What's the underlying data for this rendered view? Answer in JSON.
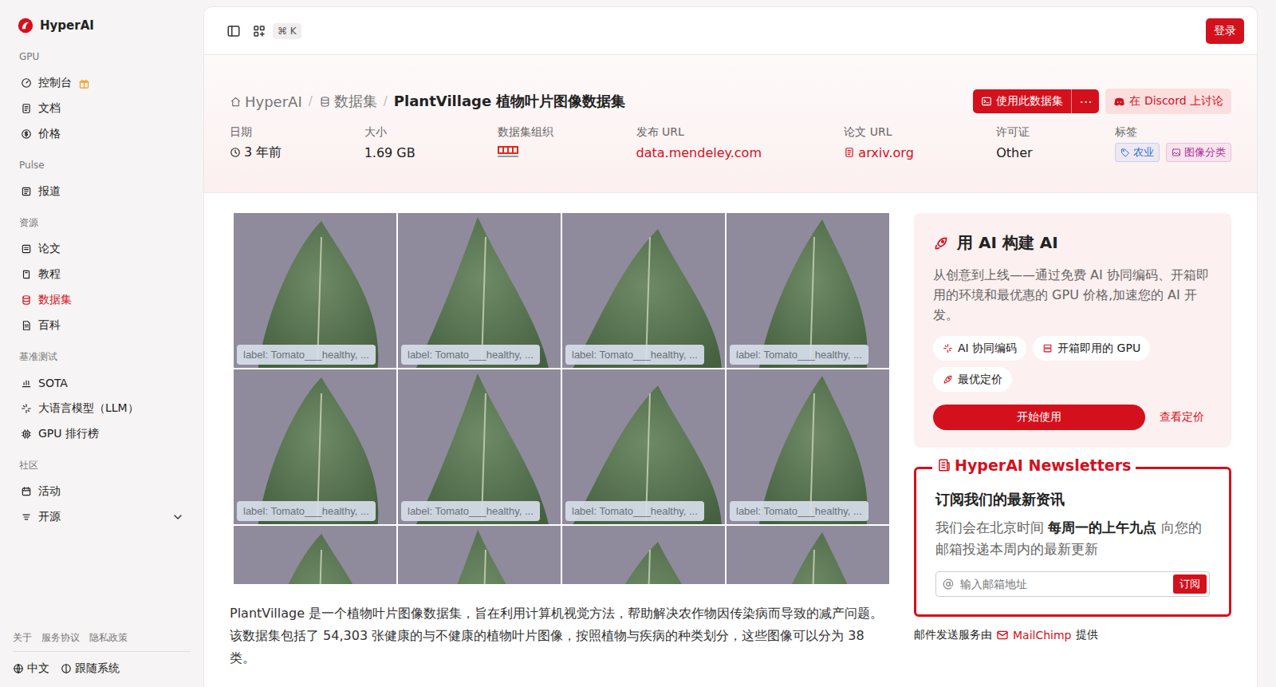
{
  "brand": {
    "name": "HyperAI"
  },
  "sidebar": {
    "sections": [
      {
        "title": "GPU",
        "items": [
          {
            "label": "控制台",
            "kind": "promo",
            "selected": false
          },
          {
            "label": "文档",
            "kind": "link",
            "selected": false
          },
          {
            "label": "价格",
            "kind": "link",
            "selected": false
          }
        ]
      },
      {
        "title": "Pulse",
        "items": [
          {
            "label": "报道",
            "kind": "link",
            "selected": false
          }
        ]
      },
      {
        "title": "资源",
        "items": [
          {
            "label": "论文",
            "kind": "link",
            "selected": false
          },
          {
            "label": "教程",
            "kind": "link",
            "selected": false
          },
          {
            "label": "数据集",
            "kind": "link",
            "selected": true
          },
          {
            "label": "百科",
            "kind": "link",
            "selected": false
          }
        ]
      },
      {
        "title": "基准测试",
        "items": [
          {
            "label": "SOTA",
            "kind": "link",
            "selected": false
          },
          {
            "label": "大语言模型（LLM）",
            "kind": "link",
            "selected": false
          },
          {
            "label": "GPU 排行榜",
            "kind": "link",
            "selected": false
          }
        ]
      },
      {
        "title": "社区",
        "items": [
          {
            "label": "活动",
            "kind": "link",
            "selected": false
          },
          {
            "label": "开源",
            "kind": "group",
            "selected": false,
            "expanded": false
          }
        ]
      }
    ],
    "footer_links": [
      "关于",
      "服务协议",
      "隐私政策"
    ],
    "language": "中文",
    "theme": "跟随系统"
  },
  "topbar": {
    "shortcut": "⌘ K",
    "login": "登录"
  },
  "breadcrumb": {
    "separator": "/",
    "items": [
      "HyperAI",
      "数据集",
      "PlantVillage 植物叶片图像数据集"
    ]
  },
  "actions": {
    "use": "使用此数据集",
    "more": "⋯",
    "discord": "在 Discord 上讨论"
  },
  "meta": [
    {
      "label": "日期",
      "kind": "time",
      "value": "3 年前"
    },
    {
      "label": "大小",
      "kind": "text",
      "value": "1.69 GB"
    },
    {
      "label": "数据集组织",
      "kind": "logo"
    },
    {
      "label": "发布 URL",
      "kind": "link",
      "value": "data.mendeley.com"
    },
    {
      "label": "论文 URL",
      "kind": "paper",
      "value": "arxiv.org"
    },
    {
      "label": "许可证",
      "kind": "text",
      "value": "Other"
    },
    {
      "label": "标签",
      "kind": "tags",
      "tags": [
        {
          "label": "农业",
          "color": "#2f6fde"
        },
        {
          "label": "图像分类",
          "color": "#b0309e"
        }
      ]
    }
  ],
  "gallery": [
    {
      "kind": "labeled",
      "label": "label: Tomato___healthy, ..."
    },
    {
      "kind": "labeled",
      "label": "label: Tomato___healthy, ..."
    },
    {
      "kind": "labeled",
      "label": "label: Tomato___healthy, ..."
    },
    {
      "kind": "labeled",
      "label": "label: Tomato___healthy, ..."
    },
    {
      "kind": "labeled",
      "label": "label: Tomato___healthy, ..."
    },
    {
      "kind": "labeled",
      "label": "label: Tomato___healthy, ..."
    },
    {
      "kind": "labeled",
      "label": "label: Tomato___healthy, ..."
    },
    {
      "kind": "labeled",
      "label": "label: Tomato___healthy, ..."
    },
    {
      "kind": "cut"
    },
    {
      "kind": "cut"
    },
    {
      "kind": "cut"
    },
    {
      "kind": "cut"
    }
  ],
  "description": "PlantVillage 是一个植物叶片图像数据集，旨在利用计算机视觉方法，帮助解决农作物因传染病而导致的减产问题。该数据集包括了 54,303 张健康的与不健康的植物叶片图像，按照植物与疾病的种类划分，这些图像可以分为 38 类。",
  "promo": {
    "title": "用 AI 构建 AI",
    "text": "从创意到上线——通过免费 AI 协同编码、开箱即用的环境和最优惠的 GPU 价格,加速您的 AI 开发。",
    "chips": [
      "AI 协同编码",
      "开箱即用的 GPU",
      "最优定价"
    ],
    "start": "开始使用",
    "pricing": "查看定价"
  },
  "newsletter": {
    "title": "HyperAI Newsletters",
    "heading": "订阅我们的最新资讯",
    "text_before": "我们会在北京时间 ",
    "text_bold": "每周一的上午九点",
    "text_after": " 向您的邮箱投递本周内的最新更新",
    "placeholder": "输入邮箱地址",
    "button": "订阅"
  },
  "mail_credit": {
    "before": "邮件发送服务由",
    "brand": "MailChimp",
    "after": "提供"
  }
}
